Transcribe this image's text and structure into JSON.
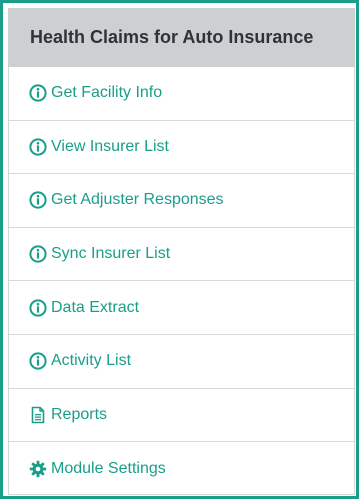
{
  "panel": {
    "title": "Health Claims for Auto Insurance",
    "accent_color": "#1a9e8a",
    "header_bg": "#cdd0d3"
  },
  "menu": {
    "items": [
      {
        "label": "Get Facility Info",
        "icon": "info-circle-icon"
      },
      {
        "label": "View Insurer List",
        "icon": "info-circle-icon"
      },
      {
        "label": "Get Adjuster Responses",
        "icon": "info-circle-icon"
      },
      {
        "label": "Sync Insurer List",
        "icon": "info-circle-icon"
      },
      {
        "label": "Data Extract",
        "icon": "info-circle-icon"
      },
      {
        "label": "Activity List",
        "icon": "info-circle-icon"
      },
      {
        "label": "Reports",
        "icon": "document-icon"
      },
      {
        "label": "Module Settings",
        "icon": "gear-icon"
      }
    ]
  }
}
